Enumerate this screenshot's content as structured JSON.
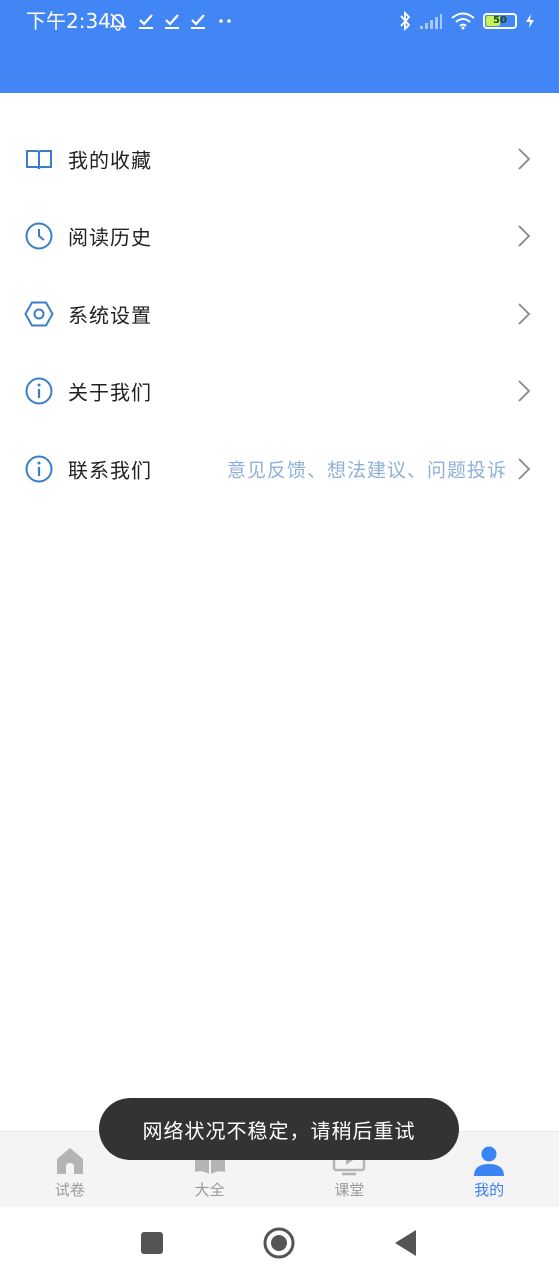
{
  "status_bar": {
    "time": "下午2:34",
    "battery_level": "50",
    "icons_left": [
      "muted-bell-icon",
      "check-icon",
      "check-icon",
      "check-icon",
      "more-dots-icon"
    ],
    "icons_right": [
      "bluetooth-icon",
      "signal-icon",
      "wifi-icon",
      "battery-icon",
      "charging-icon"
    ]
  },
  "colors": {
    "header": "#4285f4",
    "icon_blue": "#3c7ec4",
    "hint_blue": "#8fb0d8",
    "tab_active": "#3a84f3",
    "tab_inactive": "#9a9a9a",
    "toast_bg": "#333333"
  },
  "menu": {
    "items": [
      {
        "label": "我的收藏",
        "icon": "book-icon",
        "hint": ""
      },
      {
        "label": "阅读历史",
        "icon": "clock-icon",
        "hint": ""
      },
      {
        "label": "系统设置",
        "icon": "settings-hexagon-icon",
        "hint": ""
      },
      {
        "label": "关于我们",
        "icon": "info-icon",
        "hint": ""
      },
      {
        "label": "联系我们",
        "icon": "info-icon",
        "hint": "意见反馈、想法建议、问题投诉"
      }
    ]
  },
  "toast": {
    "text": "网络状况不稳定，请稍后重试"
  },
  "tabbar": {
    "tabs": [
      {
        "label": "试卷",
        "icon": "home-icon",
        "active": false
      },
      {
        "label": "大全",
        "icon": "book-open-icon",
        "active": false
      },
      {
        "label": "课堂",
        "icon": "tv-play-icon",
        "active": false
      },
      {
        "label": "我的",
        "icon": "user-icon",
        "active": true
      }
    ]
  },
  "system_nav": {
    "buttons": [
      "recents-square-icon",
      "home-circle-icon",
      "back-triangle-icon"
    ]
  }
}
